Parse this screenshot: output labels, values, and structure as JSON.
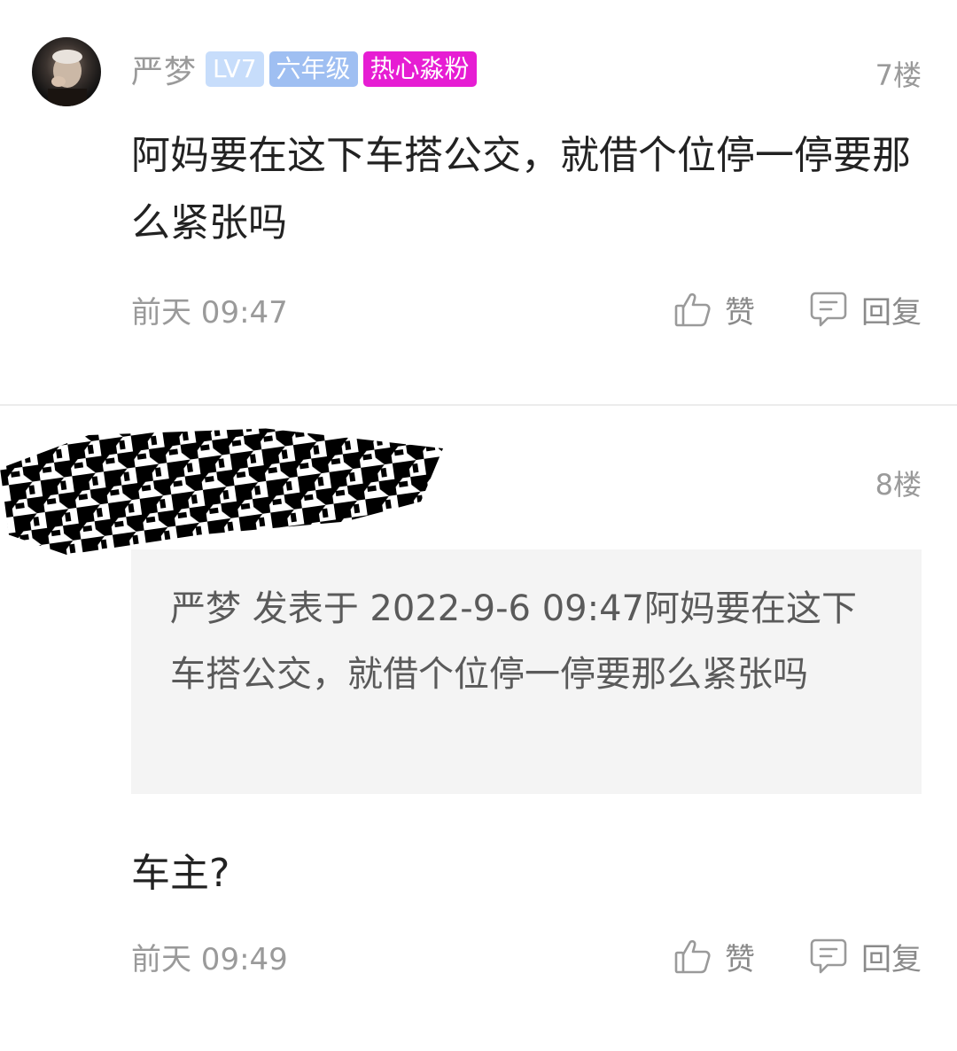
{
  "posts": [
    {
      "username": "严梦",
      "badges": [
        "LV7",
        "六年级",
        "热心淼粉"
      ],
      "floor": "7楼",
      "content": "阿妈要在这下车搭公交，就借个位停一停要那么紧张吗",
      "time": "前天 09:47",
      "like_label": "赞",
      "reply_label": "回复"
    },
    {
      "floor": "8楼",
      "quote": "严梦 发表于 2022-9-6 09:47阿妈要在这下车搭公交，就借个位停一停要那么紧张吗",
      "content": "车主?",
      "time": "前天 09:49",
      "like_label": "赞",
      "reply_label": "回复"
    }
  ],
  "icons": {
    "like": "thumbs-up-icon",
    "reply": "comment-icon"
  },
  "colors": {
    "fan_badge": "#e61dd3",
    "lv_badge": "#c7ddfb",
    "grade_badge": "#9fbff2",
    "meta_text": "#9a9a9a"
  }
}
